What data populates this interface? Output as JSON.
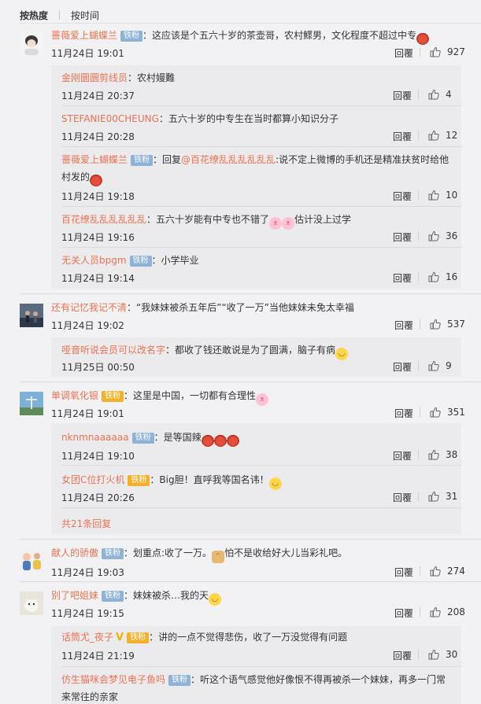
{
  "sort": {
    "hot": "按热度",
    "time": "按时间"
  },
  "ui": {
    "reply": "回覆"
  },
  "comments": [
    {
      "name": "蔷薇爱上蝴蝶兰",
      "badge": "铁粉",
      "text": "：这应该是个五六十岁的茶壶哥，农村鰥男，文化程度不超过中专",
      "time": "11月24日 19:01",
      "likes": "927",
      "replies": [
        {
          "name": "金刚圜圜剪线员",
          "text": "：农村嫚難",
          "time": "11月24日 20:37",
          "likes": "4"
        },
        {
          "name": "STEFANIE00CHEUNG",
          "text": "：五六十岁的中专生在当时都算小知识分子",
          "time": "11月24日 20:28",
          "likes": "12"
        },
        {
          "name": "蔷薇爱上蝴蝶兰",
          "badge": "铁粉",
          "prefix": "：回复",
          "mention": "@百花缭乱乱乱乱乱乱",
          "text": ":说不定上微博的手机还是精准扶贫时给他",
          "text2": "村发的",
          "time": "11月24日 19:18",
          "likes": "10"
        },
        {
          "name": "百花缭乱乱乱乱乱乱",
          "text": "：五六十岁能有中专也不错了",
          "text2": "估计没上过学",
          "time": "11月24日 19:16",
          "likes": "36"
        },
        {
          "name": "无关人员bpgm",
          "badge": "铁粉",
          "text": "：小学毕业",
          "time": "11月24日 19:14",
          "likes": "16"
        }
      ]
    },
    {
      "name": "还有记忆我记不清",
      "text": "：“我妹妹被杀五年后”“收了一万”当他妹妹未免太幸福",
      "time": "11月24日 19:02",
      "likes": "537",
      "replies": [
        {
          "name": "哑音听说会员可以改名字",
          "text": "：都收了钱还敢说是为了圆满，脑子有病",
          "time": "11月25日 00:50",
          "likes": "9"
        }
      ]
    },
    {
      "name": "单调氧化银",
      "badge": "铁粉",
      "text": "：这里是中国，一切都有合理性",
      "time": "11月24日 19:01",
      "likes": "351",
      "replies": [
        {
          "name": "nknmnaaaaaa",
          "badge": "铁粉",
          "text": "：是等国辣",
          "time": "11月24日 19:10",
          "likes": "38"
        },
        {
          "name": "女团C位打火机",
          "badge": "铁粉",
          "text": "：Big胆！直呼我等国名讳！",
          "time": "11月24日 20:26",
          "likes": "31"
        }
      ],
      "more": "共21条回复"
    },
    {
      "name": "献人的骄傲",
      "badge": "铁粉",
      "text": "：划重点:收了一万。",
      "text2": "怕不是收给好大儿当彩礼吧。",
      "time": "11月24日 19:03",
      "likes": "274"
    },
    {
      "name": "别了吧姐妹",
      "badge": "铁粉",
      "text": "：妹妹被杀…我的天",
      "time": "11月24日 19:15",
      "likes": "208",
      "replies": [
        {
          "name": "话筒尤_夜子",
          "badge": "铁粉",
          "text": "：讲的一点不觉得悲伤，收了一万没觉得有问题",
          "time": "11月24日 21:19",
          "likes": "30"
        },
        {
          "name": "仿生猫咪会梦见电子鱼吗",
          "badge": "铁粉",
          "text": "：听这个语气感觉他好像恨不得再被杀一个妹妹，再多一门常",
          "text2": "来常往的亲家"
        }
      ]
    }
  ]
}
